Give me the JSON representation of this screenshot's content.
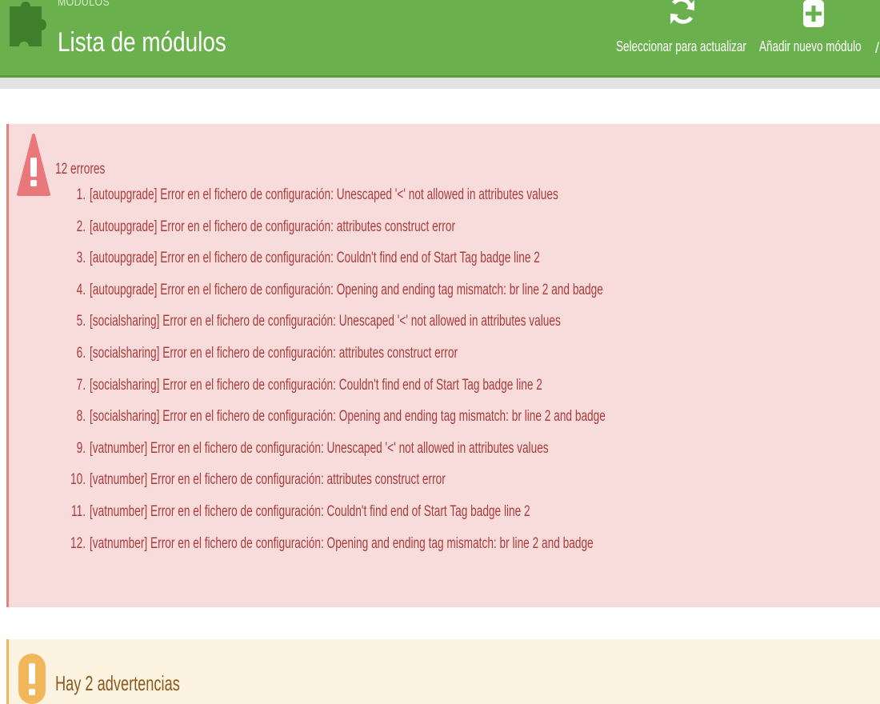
{
  "header": {
    "breadcrumb": "MÓDULOS",
    "title": "Lista de módulos",
    "icon": "puzzle-icon",
    "buttons": [
      {
        "label": "Seleccionar para actualizar",
        "icon": "refresh-icon"
      },
      {
        "label": "Añadir nuevo módulo",
        "icon": "add-icon"
      }
    ],
    "accent_color": "#6ab04c"
  },
  "errors": {
    "count_label": "12 errores",
    "icon": "warning-triangle-icon",
    "items": [
      {
        "num": "1.",
        "text": "[autoupgrade] Error en el fichero de configuración: Unescaped '<' not allowed in attributes values"
      },
      {
        "num": "2.",
        "text": "[autoupgrade] Error en el fichero de configuración: attributes construct error"
      },
      {
        "num": "3.",
        "text": "[autoupgrade] Error en el fichero de configuración: Couldn't find end of Start Tag badge line 2"
      },
      {
        "num": "4.",
        "text": "[autoupgrade] Error en el fichero de configuración: Opening and ending tag mismatch: br line 2 and badge"
      },
      {
        "num": "5.",
        "text": "[socialsharing] Error en el fichero de configuración: Unescaped '<' not allowed in attributes values"
      },
      {
        "num": "6.",
        "text": "[socialsharing] Error en el fichero de configuración: attributes construct error"
      },
      {
        "num": "7.",
        "text": "[socialsharing] Error en el fichero de configuración: Couldn't find end of Start Tag badge line 2"
      },
      {
        "num": "8.",
        "text": "[socialsharing] Error en el fichero de configuración: Opening and ending tag mismatch: br line 2 and badge"
      },
      {
        "num": "9.",
        "text": "[vatnumber] Error en el fichero de configuración: Unescaped '<' not allowed in attributes values"
      },
      {
        "num": "10.",
        "text": "[vatnumber] Error en el fichero de configuración: attributes construct error"
      },
      {
        "num": "11.",
        "text": "[vatnumber] Error en el fichero de configuración: Couldn't find end of Start Tag badge line 2"
      },
      {
        "num": "12.",
        "text": "[vatnumber] Error en el fichero de configuración: Opening and ending tag mismatch: br line 2 and badge"
      }
    ],
    "color": "#aa3c3c",
    "background": "#f8dcdc"
  },
  "warnings": {
    "title": "Hay 2 advertencias",
    "icon": "exclamation-icon",
    "color": "#f2b75b",
    "background": "#fdf3e1"
  }
}
